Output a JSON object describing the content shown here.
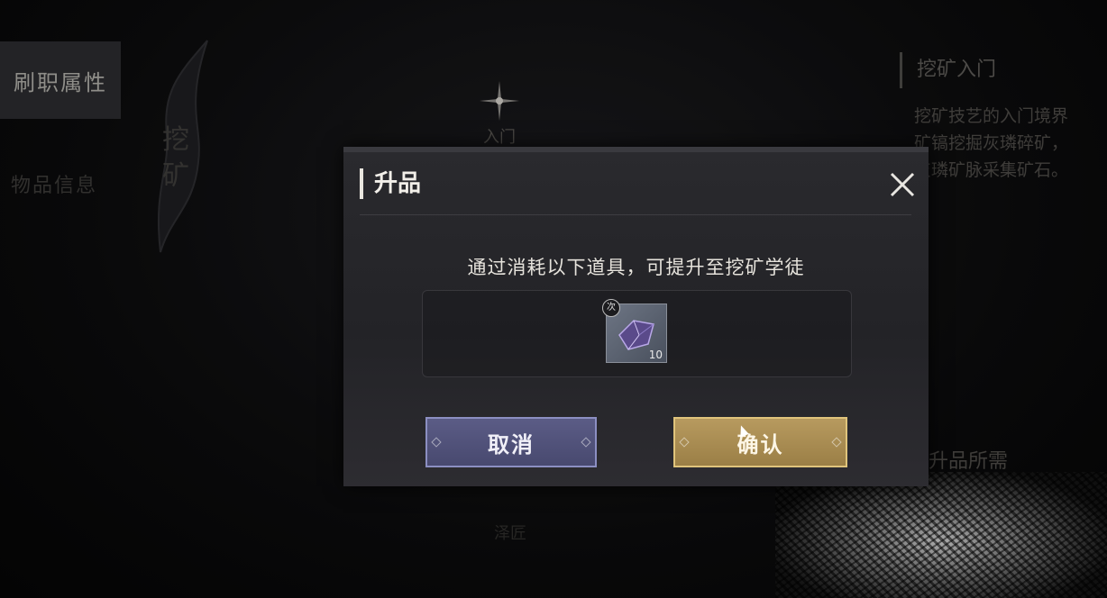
{
  "left_tabs": {
    "active": "刷职属性",
    "items": [
      "物品信息"
    ]
  },
  "emblem": {
    "text": "挖矿"
  },
  "skill_tree": {
    "node_top": "入门",
    "node_bottom": "泽匠"
  },
  "right_panel": {
    "title": "挖矿入门",
    "description_lines": [
      "挖矿技艺的入门境界",
      "矿镐挖掘灰璘碎矿，",
      "灰璘矿脉采集矿石。"
    ],
    "upgrade_needs_label": "升品所需"
  },
  "dialog": {
    "title": "升品",
    "message": "通过消耗以下道具，可提升至挖矿学徒",
    "item": {
      "icon": "purple-crystal-ore-icon",
      "badge": "次",
      "count": "10"
    },
    "cancel_label": "取消",
    "confirm_label": "确认"
  },
  "colors": {
    "cancel_button": "#5b5c86",
    "confirm_button": "#b79a5f",
    "dialog_bg": "#2a2a2e"
  }
}
